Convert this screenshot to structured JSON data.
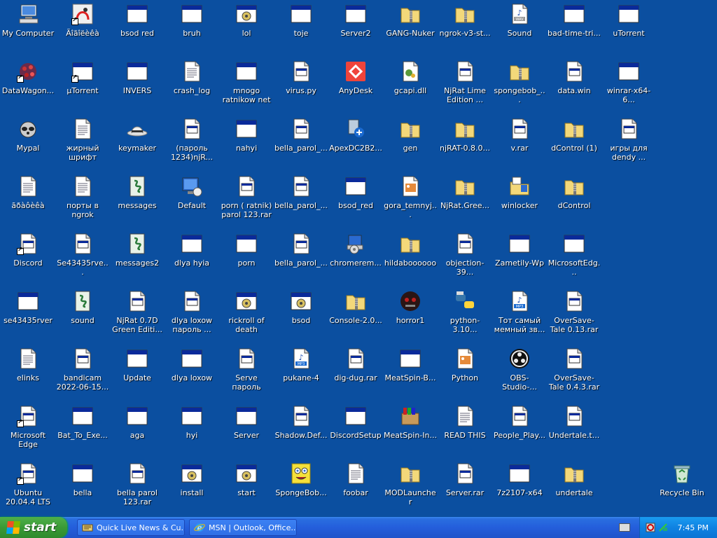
{
  "desktop": {
    "icons": [
      {
        "label": "My Computer",
        "icon": "computer-icon",
        "col": 0,
        "row": 0,
        "shortcut": false
      },
      {
        "label": "Ãîãîëèêà",
        "icon": "app-shortcut-icon",
        "col": 1,
        "row": 0,
        "shortcut": true
      },
      {
        "label": "bsod red",
        "icon": "window-icon",
        "col": 2,
        "row": 0,
        "shortcut": false
      },
      {
        "label": "bruh",
        "icon": "window-icon",
        "col": 3,
        "row": 0,
        "shortcut": false
      },
      {
        "label": "lol",
        "icon": "gear-window-icon",
        "col": 4,
        "row": 0,
        "shortcut": false
      },
      {
        "label": "toje",
        "icon": "window-icon",
        "col": 5,
        "row": 0,
        "shortcut": false
      },
      {
        "label": "Server2",
        "icon": "window-icon",
        "col": 6,
        "row": 0,
        "shortcut": false
      },
      {
        "label": "GANG-Nuker",
        "icon": "zip-folder-icon",
        "col": 7,
        "row": 0,
        "shortcut": false
      },
      {
        "label": "ngrok-v3-st...",
        "icon": "zip-folder-icon",
        "col": 8,
        "row": 0,
        "shortcut": false
      },
      {
        "label": "Sound",
        "icon": "wav-file-icon",
        "col": 9,
        "row": 0,
        "shortcut": false
      },
      {
        "label": "bad-time-tri...",
        "icon": "window-icon",
        "col": 10,
        "row": 0,
        "shortcut": false
      },
      {
        "label": "uTorrent",
        "icon": "window-icon",
        "col": 11,
        "row": 0,
        "shortcut": false
      },
      {
        "label": "DataWagon...",
        "icon": "datawagon-icon",
        "col": 0,
        "row": 1,
        "shortcut": true
      },
      {
        "label": "µTorrent",
        "icon": "window-icon",
        "col": 1,
        "row": 1,
        "shortcut": true
      },
      {
        "label": "INVERS",
        "icon": "window-icon",
        "col": 2,
        "row": 1,
        "shortcut": false
      },
      {
        "label": "crash_log",
        "icon": "text-file-icon",
        "col": 3,
        "row": 1,
        "shortcut": false
      },
      {
        "label": "mnogo ratnikow net",
        "icon": "window-icon",
        "col": 4,
        "row": 1,
        "shortcut": false
      },
      {
        "label": "virus.py",
        "icon": "file-icon",
        "col": 5,
        "row": 1,
        "shortcut": false
      },
      {
        "label": "AnyDesk",
        "icon": "anydesk-icon",
        "col": 6,
        "row": 1,
        "shortcut": false
      },
      {
        "label": "gcapi.dll",
        "icon": "dll-icon",
        "col": 7,
        "row": 1,
        "shortcut": false
      },
      {
        "label": "NjRat Lime Edition ...",
        "icon": "file-icon",
        "col": 8,
        "row": 1,
        "shortcut": false
      },
      {
        "label": "spongebob_...",
        "icon": "zip-folder-icon",
        "col": 9,
        "row": 1,
        "shortcut": false
      },
      {
        "label": "data.win",
        "icon": "file-icon",
        "col": 10,
        "row": 1,
        "shortcut": false
      },
      {
        "label": "winrar-x64-6...",
        "icon": "window-icon",
        "col": 11,
        "row": 1,
        "shortcut": false
      },
      {
        "label": "Mypal",
        "icon": "raccoon-icon",
        "col": 0,
        "row": 2,
        "shortcut": false
      },
      {
        "label": "жирный шрифт",
        "icon": "text-file-icon",
        "col": 1,
        "row": 2,
        "shortcut": false
      },
      {
        "label": "keymaker",
        "icon": "hat-icon",
        "col": 2,
        "row": 2,
        "shortcut": false
      },
      {
        "label": "(пароль 1234)njR...",
        "icon": "file-icon",
        "col": 3,
        "row": 2,
        "shortcut": false
      },
      {
        "label": "nahyi",
        "icon": "window-icon",
        "col": 4,
        "row": 2,
        "shortcut": false
      },
      {
        "label": "bella_parol_...",
        "icon": "file-icon",
        "col": 5,
        "row": 2,
        "shortcut": false
      },
      {
        "label": "ApexDC2B2...",
        "icon": "apexdc-icon",
        "col": 6,
        "row": 2,
        "shortcut": false
      },
      {
        "label": "gen",
        "icon": "zip-folder-icon",
        "col": 7,
        "row": 2,
        "shortcut": false
      },
      {
        "label": "njRAT-0.8.0...",
        "icon": "zip-folder-icon",
        "col": 8,
        "row": 2,
        "shortcut": false
      },
      {
        "label": "v.rar",
        "icon": "file-icon",
        "col": 9,
        "row": 2,
        "shortcut": false
      },
      {
        "label": "dControl (1)",
        "icon": "zip-folder-icon",
        "col": 10,
        "row": 2,
        "shortcut": false
      },
      {
        "label": "игры для dendy ...",
        "icon": "file-icon",
        "col": 11,
        "row": 2,
        "shortcut": false
      },
      {
        "label": "ãðàôèêà",
        "icon": "text-file-icon",
        "col": 0,
        "row": 3,
        "shortcut": false
      },
      {
        "label": "порты в ngrok",
        "icon": "text-file-icon",
        "col": 1,
        "row": 3,
        "shortcut": false
      },
      {
        "label": "messages",
        "icon": "script-icon",
        "col": 2,
        "row": 3,
        "shortcut": false
      },
      {
        "label": "Default",
        "icon": "default-icon",
        "col": 3,
        "row": 3,
        "shortcut": false
      },
      {
        "label": "porn ( ratnik) parol 123.rar",
        "icon": "file-icon",
        "col": 4,
        "row": 3,
        "shortcut": false
      },
      {
        "label": "bella_parol_...",
        "icon": "file-icon",
        "col": 5,
        "row": 3,
        "shortcut": false
      },
      {
        "label": "bsod_red",
        "icon": "window-icon",
        "col": 6,
        "row": 3,
        "shortcut": false
      },
      {
        "label": "gora_temnyj...",
        "icon": "image-file-icon",
        "col": 7,
        "row": 3,
        "shortcut": false
      },
      {
        "label": "NjRat.Gree...",
        "icon": "zip-folder-icon",
        "col": 8,
        "row": 3,
        "shortcut": false
      },
      {
        "label": "winlocker",
        "icon": "winlocker-icon",
        "col": 9,
        "row": 3,
        "shortcut": false
      },
      {
        "label": "dControl",
        "icon": "zip-folder-icon",
        "col": 10,
        "row": 3,
        "shortcut": false
      },
      {
        "label": "Discord",
        "icon": "file-icon",
        "col": 0,
        "row": 4,
        "shortcut": true
      },
      {
        "label": "Se43435rve...",
        "icon": "file-icon",
        "col": 1,
        "row": 4,
        "shortcut": false
      },
      {
        "label": "messages2",
        "icon": "script-icon",
        "col": 2,
        "row": 4,
        "shortcut": false
      },
      {
        "label": "dlya hyia",
        "icon": "window-icon",
        "col": 3,
        "row": 4,
        "shortcut": false
      },
      {
        "label": "porn",
        "icon": "window-icon",
        "col": 4,
        "row": 4,
        "shortcut": false
      },
      {
        "label": "bella_parol_...",
        "icon": "file-icon",
        "col": 5,
        "row": 4,
        "shortcut": false
      },
      {
        "label": "chromerem...",
        "icon": "installer-icon",
        "col": 6,
        "row": 4,
        "shortcut": false
      },
      {
        "label": "hildaboooooo",
        "icon": "zip-folder-icon",
        "col": 7,
        "row": 4,
        "shortcut": false
      },
      {
        "label": "objection-39...",
        "icon": "file-icon",
        "col": 8,
        "row": 4,
        "shortcut": false
      },
      {
        "label": "Zametily-Wp",
        "icon": "window-icon",
        "col": 9,
        "row": 4,
        "shortcut": false
      },
      {
        "label": "MicrosoftEdg...",
        "icon": "window-icon",
        "col": 10,
        "row": 4,
        "shortcut": false
      },
      {
        "label": "se43435rver",
        "icon": "window-icon",
        "col": 0,
        "row": 5,
        "shortcut": false
      },
      {
        "label": "sound",
        "icon": "script-icon",
        "col": 1,
        "row": 5,
        "shortcut": false
      },
      {
        "label": "NjRat 0.7D Green Editi...",
        "icon": "file-icon",
        "col": 2,
        "row": 5,
        "shortcut": false
      },
      {
        "label": "dlya loxow пароль ...",
        "icon": "file-icon",
        "col": 3,
        "row": 5,
        "shortcut": false
      },
      {
        "label": "rickroll of death",
        "icon": "gear-window-icon",
        "col": 4,
        "row": 5,
        "shortcut": false
      },
      {
        "label": "bsod",
        "icon": "gear-window-icon",
        "col": 5,
        "row": 5,
        "shortcut": false
      },
      {
        "label": "Console-2.0...",
        "icon": "zip-folder-icon",
        "col": 6,
        "row": 5,
        "shortcut": false
      },
      {
        "label": "horror1",
        "icon": "horror-icon",
        "col": 7,
        "row": 5,
        "shortcut": false
      },
      {
        "label": "python-3.10...",
        "icon": "python-icon",
        "col": 8,
        "row": 5,
        "shortcut": false
      },
      {
        "label": "Тот самый мемный зв...",
        "icon": "mp3-file-icon",
        "col": 9,
        "row": 5,
        "shortcut": false
      },
      {
        "label": "OverSave-Tale 0.13.rar",
        "icon": "file-icon",
        "col": 10,
        "row": 5,
        "shortcut": false
      },
      {
        "label": "elinks",
        "icon": "text-file-icon",
        "col": 0,
        "row": 6,
        "shortcut": false
      },
      {
        "label": "bandicam 2022-06-15...",
        "icon": "file-icon",
        "col": 1,
        "row": 6,
        "shortcut": false
      },
      {
        "label": "Update",
        "icon": "window-icon",
        "col": 2,
        "row": 6,
        "shortcut": false
      },
      {
        "label": "dlya loxow",
        "icon": "window-icon",
        "col": 3,
        "row": 6,
        "shortcut": false
      },
      {
        "label": "Serve пароль 123r.rar",
        "icon": "file-icon",
        "col": 4,
        "row": 6,
        "shortcut": false
      },
      {
        "label": "pukane-4",
        "icon": "mp3-file-icon",
        "col": 5,
        "row": 6,
        "shortcut": false
      },
      {
        "label": "dig-dug.rar",
        "icon": "file-icon",
        "col": 6,
        "row": 6,
        "shortcut": false
      },
      {
        "label": "MeatSpin-B...",
        "icon": "window-icon",
        "col": 7,
        "row": 6,
        "shortcut": false
      },
      {
        "label": "Python",
        "icon": "image-file-icon",
        "col": 8,
        "row": 6,
        "shortcut": false
      },
      {
        "label": "OBS-Studio-...",
        "icon": "obs-icon",
        "col": 9,
        "row": 6,
        "shortcut": false
      },
      {
        "label": "OverSave-Tale 0.4.3.rar",
        "icon": "file-icon",
        "col": 10,
        "row": 6,
        "shortcut": false
      },
      {
        "label": "Microsoft Edge",
        "icon": "file-icon",
        "col": 0,
        "row": 7,
        "shortcut": true
      },
      {
        "label": "Bat_To_Exe...",
        "icon": "window-icon",
        "col": 1,
        "row": 7,
        "shortcut": false
      },
      {
        "label": "aga",
        "icon": "window-icon",
        "col": 2,
        "row": 7,
        "shortcut": false
      },
      {
        "label": "hyi",
        "icon": "window-icon",
        "col": 3,
        "row": 7,
        "shortcut": false
      },
      {
        "label": "Server",
        "icon": "window-icon",
        "col": 4,
        "row": 7,
        "shortcut": false
      },
      {
        "label": "Shadow.Def...",
        "icon": "file-icon",
        "col": 5,
        "row": 7,
        "shortcut": false
      },
      {
        "label": "DiscordSetup",
        "icon": "window-icon",
        "col": 6,
        "row": 7,
        "shortcut": false
      },
      {
        "label": "MeatSpin-In...",
        "icon": "package-icon",
        "col": 7,
        "row": 7,
        "shortcut": false
      },
      {
        "label": "READ THIS",
        "icon": "text-file-icon",
        "col": 8,
        "row": 7,
        "shortcut": false
      },
      {
        "label": "People_Play...",
        "icon": "file-icon",
        "col": 9,
        "row": 7,
        "shortcut": false
      },
      {
        "label": "Undertale.t...",
        "icon": "file-icon",
        "col": 10,
        "row": 7,
        "shortcut": false
      },
      {
        "label": "Ubuntu 20.04.4 LTS",
        "icon": "file-icon",
        "col": 0,
        "row": 8,
        "shortcut": true
      },
      {
        "label": "bella",
        "icon": "window-icon",
        "col": 1,
        "row": 8,
        "shortcut": false
      },
      {
        "label": "bella parol 123.rar",
        "icon": "file-icon",
        "col": 2,
        "row": 8,
        "shortcut": false
      },
      {
        "label": "install",
        "icon": "gear-window-icon",
        "col": 3,
        "row": 8,
        "shortcut": false
      },
      {
        "label": "start",
        "icon": "gear-window-icon",
        "col": 4,
        "row": 8,
        "shortcut": false
      },
      {
        "label": "SpongeBob...",
        "icon": "spongebob-icon",
        "col": 5,
        "row": 8,
        "shortcut": false
      },
      {
        "label": "foobar",
        "icon": "text-file-icon",
        "col": 6,
        "row": 8,
        "shortcut": false
      },
      {
        "label": "MODLauncher",
        "icon": "zip-folder-icon",
        "col": 7,
        "row": 8,
        "shortcut": false
      },
      {
        "label": "Server.rar",
        "icon": "file-icon",
        "col": 8,
        "row": 8,
        "shortcut": false
      },
      {
        "label": "7z2107-x64",
        "icon": "window-icon",
        "col": 9,
        "row": 8,
        "shortcut": false
      },
      {
        "label": "undertale",
        "icon": "zip-folder-icon",
        "col": 10,
        "row": 8,
        "shortcut": false
      },
      {
        "label": "Recycle Bin",
        "icon": "recycle-bin-icon",
        "col": 12,
        "row": 8,
        "shortcut": false
      }
    ]
  },
  "taskbar": {
    "start_label": "start",
    "tasks": [
      {
        "label": "Quick Live News & Cu...",
        "icon": "news-icon"
      },
      {
        "label": "MSN | Outlook, Office...",
        "icon": "ie-icon"
      }
    ],
    "clock": "7:45 PM"
  },
  "colors": {
    "desktop": "#0b4fa0",
    "taskbar": "#245edb",
    "start": "#3a9a36",
    "tray": "#0f82e2"
  }
}
